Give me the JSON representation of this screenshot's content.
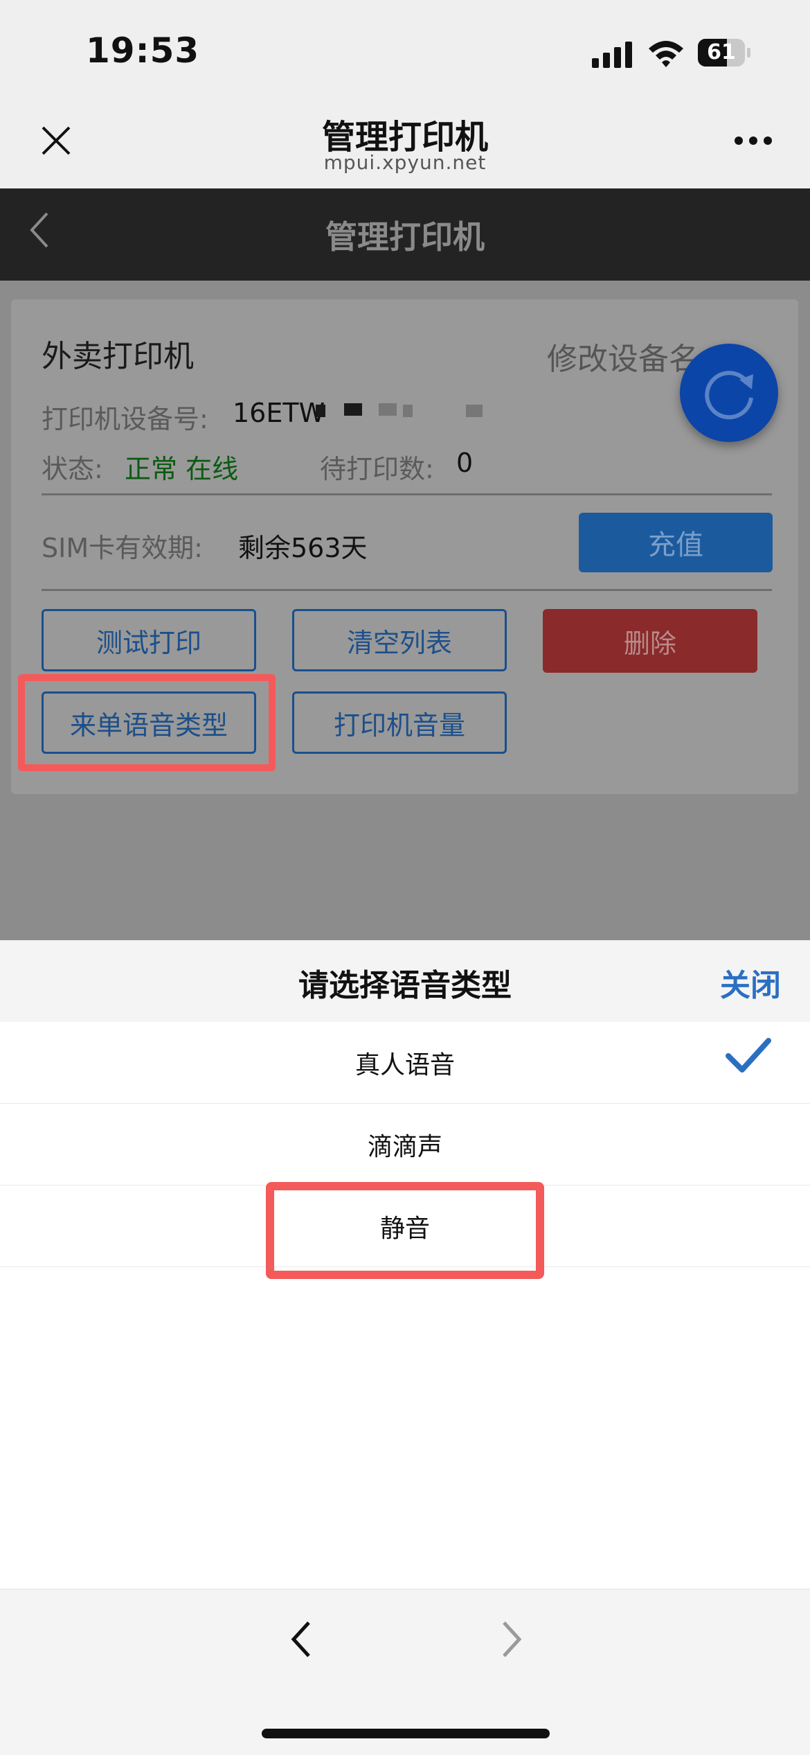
{
  "status_bar": {
    "time": "19:53",
    "battery": "61"
  },
  "wechat_header": {
    "title": "管理打印机",
    "domain": "mpui.xpyun.net"
  },
  "page": {
    "title": "管理打印机",
    "device_name": "外卖打印机",
    "rename_label": "修改设备名",
    "device_no_label": "打印机设备号:",
    "device_no_value": "16ETW",
    "status_label": "状态:",
    "status_value": "正常 在线",
    "pending_label": "待打印数:",
    "pending_value": "0",
    "sim_label": "SIM卡有效期:",
    "sim_value": "剩余563天",
    "recharge_label": "充值",
    "buttons": {
      "test_print": "测试打印",
      "clear_list": "清空列表",
      "delete": "删除",
      "voice_type": "来单语音类型",
      "volume": "打印机音量"
    }
  },
  "sheet": {
    "title": "请选择语音类型",
    "close_label": "关闭",
    "options": [
      "真人语音",
      "滴滴声",
      "静音"
    ],
    "selected_option": "真人语音"
  },
  "colors": {
    "highlight": "#f45a5a",
    "accent": "#2a6fc2",
    "refresh_button": "#0b45a8"
  }
}
